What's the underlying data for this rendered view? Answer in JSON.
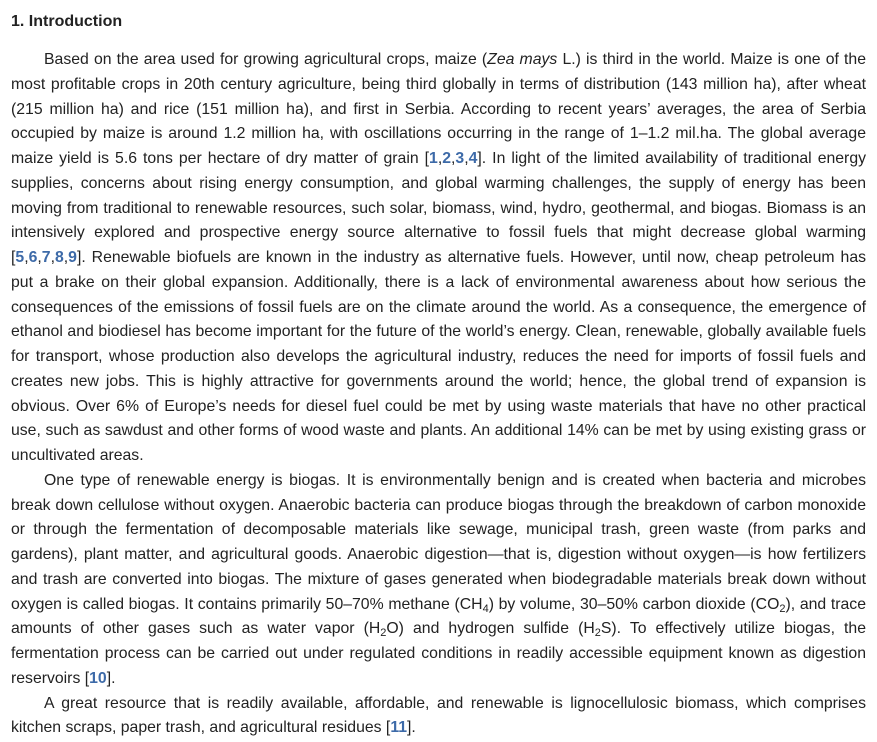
{
  "section": {
    "number": "1.",
    "title": "Introduction"
  },
  "paragraphs": [
    {
      "segments": [
        {
          "t": "Based on the area used for growing agricultural crops, maize ("
        },
        {
          "t": "Zea mays",
          "style": "em"
        },
        {
          "t": " L.) is third in the world. Maize is one of the most profitable crops in 20th century agriculture, being third globally in terms of distribution (143 million ha), after wheat (215 million ha) and rice (151 million ha), and first in Serbia. According to recent years’ averages, the area of Serbia occupied by maize is around 1.2 million ha, with oscillations occurring in the range of 1–1.2 mil.ha. The global average maize yield is 5.6 tons per hectare of dry matter of grain ["
        },
        {
          "t": "1",
          "style": "ref"
        },
        {
          "t": ","
        },
        {
          "t": "2",
          "style": "ref"
        },
        {
          "t": ","
        },
        {
          "t": "3",
          "style": "ref"
        },
        {
          "t": ","
        },
        {
          "t": "4",
          "style": "ref"
        },
        {
          "t": "]. In light of the limited availability of traditional energy supplies, concerns about rising energy consumption, and global warming challenges, the supply of energy has been moving from traditional to renewable resources, such solar, biomass, wind, hydro, geothermal, and biogas. Biomass is an intensively explored and prospective energy source alternative to fossil fuels that might decrease global warming ["
        },
        {
          "t": "5",
          "style": "ref"
        },
        {
          "t": ","
        },
        {
          "t": "6",
          "style": "ref"
        },
        {
          "t": ","
        },
        {
          "t": "7",
          "style": "ref"
        },
        {
          "t": ","
        },
        {
          "t": "8",
          "style": "ref"
        },
        {
          "t": ","
        },
        {
          "t": "9",
          "style": "ref"
        },
        {
          "t": "]. Renewable biofuels are known in the industry as alternative fuels. However, until now, cheap petroleum has put a brake on their global expansion. Additionally, there is a lack of environmental awareness about how serious the consequences of the emissions of fossil fuels are on the climate around the world. As a consequence, the emergence of ethanol and biodiesel has become important for the future of the world’s energy. Clean, renewable, globally available fuels for transport, whose production also develops the agricultural industry, reduces the need for imports of fossil fuels and creates new jobs. This is highly attractive for governments around the world; hence, the global trend of expansion is obvious. Over 6% of Europe’s needs for diesel fuel could be met by using waste materials that have no other practical use, such as sawdust and other forms of wood waste and plants. An additional 14% can be met by using existing grass or uncultivated areas."
        }
      ]
    },
    {
      "segments": [
        {
          "t": "One type of renewable energy is biogas. It is environmentally benign and is created when bacteria and microbes break down cellulose without oxygen. Anaerobic bacteria can produce biogas through the breakdown of carbon monoxide or through the fermentation of decomposable materials like sewage, municipal trash, green waste (from parks and gardens), plant matter, and agricultural goods. Anaerobic digestion—that is, digestion without oxygen—is how fertilizers and trash are converted into biogas. The mixture of gases generated when biodegradable materials break down without oxygen is called biogas. It contains primarily 50–70% methane (CH"
        },
        {
          "t": "4",
          "style": "sub"
        },
        {
          "t": ") by volume, 30–50% carbon dioxide (CO"
        },
        {
          "t": "2",
          "style": "sub"
        },
        {
          "t": "), and trace amounts of other gases such as water vapor (H"
        },
        {
          "t": "2",
          "style": "sub"
        },
        {
          "t": "O) and hydrogen sulfide (H"
        },
        {
          "t": "2",
          "style": "sub"
        },
        {
          "t": "S). To effectively utilize biogas, the fermentation process can be carried out under regulated conditions in readily accessible equipment known as digestion reservoirs ["
        },
        {
          "t": "10",
          "style": "ref"
        },
        {
          "t": "]."
        }
      ]
    },
    {
      "segments": [
        {
          "t": "A great resource that is readily available, affordable, and renewable is lignocellulosic biomass, which comprises kitchen scraps, paper trash, and agricultural residues ["
        },
        {
          "t": "11",
          "style": "ref"
        },
        {
          "t": "]."
        }
      ]
    }
  ]
}
